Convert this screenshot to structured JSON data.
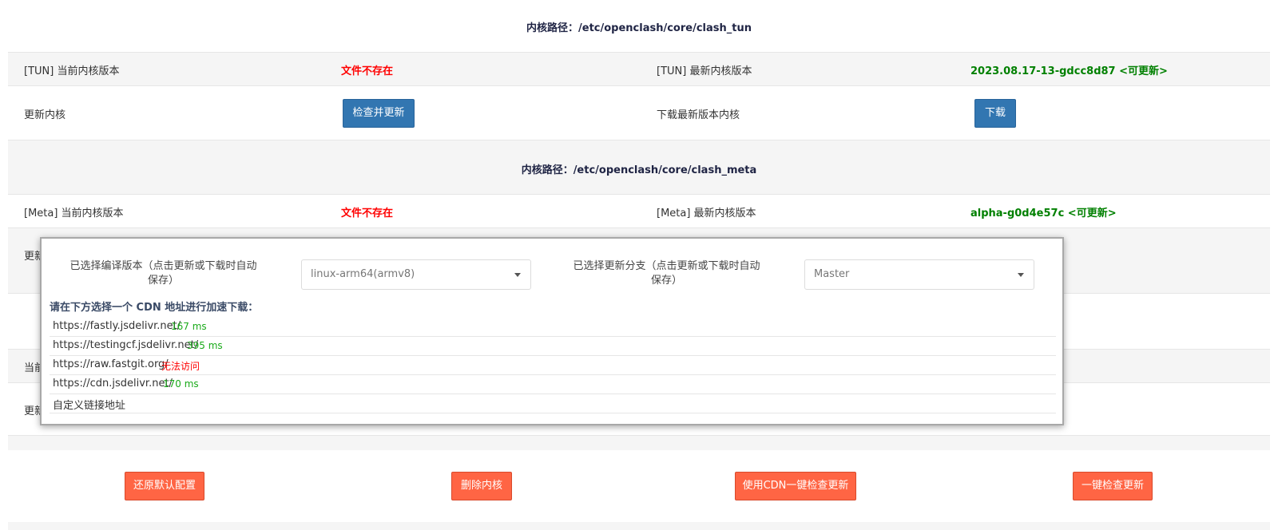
{
  "tun": {
    "path_label": "内核路径：/etc/openclash/core/clash_tun",
    "current_label": "[TUN] 当前内核版本",
    "current_value": "文件不存在",
    "latest_label": "[TUN] 最新内核版本",
    "latest_value": "2023.08.17-13-gdcc8d87 <可更新>",
    "update_label": "更新内核",
    "check_button": "检查并更新",
    "download_label": "下载最新版本内核",
    "download_button": "下载"
  },
  "meta": {
    "path_label": "内核路径：/etc/openclash/core/clash_meta",
    "current_label": "[Meta] 当前内核版本",
    "current_value": "文件不存在",
    "latest_label": "[Meta] 最新内核版本",
    "latest_value": "alpha-g0d4e57c <可更新>"
  },
  "hidden_rows": {
    "update_partial": "更新",
    "current_partial": "当前",
    "update_partial2": "更新"
  },
  "popup": {
    "arch_label": "已选择编译版本（点击更新或下载时自动保存）",
    "arch_value": "linux-arm64(armv8)",
    "branch_label": "已选择更新分支（点击更新或下载时自动保存）",
    "branch_value": "Master",
    "cdn_title": "请在下方选择一个 CDN 地址进行加速下载：",
    "cdn_list": [
      {
        "url": "https://fastly.jsdelivr.net/",
        "latency": "167 ms",
        "status": "ok"
      },
      {
        "url": "https://testingcf.jsdelivr.net/",
        "latency": "395 ms",
        "status": "ok"
      },
      {
        "url": "https://raw.fastgit.org/",
        "latency": "无法访问",
        "status": "bad"
      },
      {
        "url": "https://cdn.jsdelivr.net/",
        "latency": "170 ms",
        "status": "ok"
      },
      {
        "url": "自定义链接地址",
        "latency": "",
        "status": ""
      }
    ]
  },
  "footer": {
    "restore_button": "还原默认配置",
    "delete_button": "删除内核",
    "cdn_update_button": "使用CDN一键检查更新",
    "one_click_button": "一键检查更新"
  },
  "colors": {
    "error": "#ff0000",
    "success": "#008000",
    "primary_button": "#3276b1",
    "action_button": "#ff6544"
  }
}
